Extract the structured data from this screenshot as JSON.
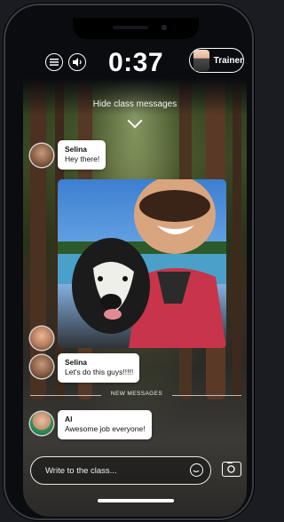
{
  "timer": "0:37",
  "trainer_button": {
    "label": "Trainer"
  },
  "hide_messages": "Hide class messages",
  "messages": [
    {
      "name": "Selina",
      "text": "Hey there!"
    },
    {
      "name": "Selina",
      "text": "Let's do this guys!!!!!"
    },
    {
      "name": "Al",
      "text": "Awesome job everyone!"
    }
  ],
  "divider": {
    "label": "NEW MESSAGES"
  },
  "composer": {
    "placeholder": "Write to the class..."
  },
  "icons": {
    "menu": "menu-icon",
    "volume": "volume-icon",
    "hide": "chevron-down-icon",
    "emoji": "smiley-icon",
    "camera": "camera-icon"
  },
  "colors": {
    "bubble": "#ffffff",
    "text_on_dark": "#ffffff",
    "background": "#0b0c0f"
  }
}
